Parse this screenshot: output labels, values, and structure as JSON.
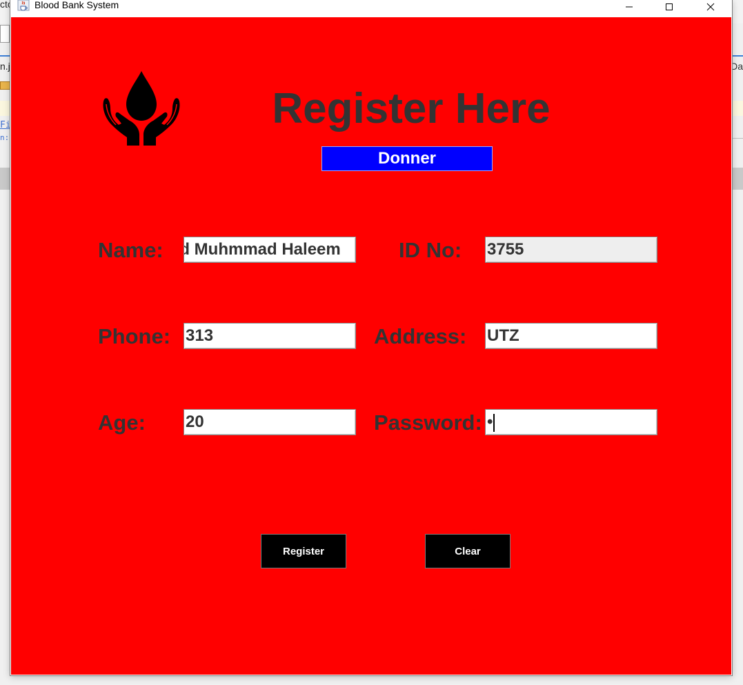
{
  "background": {
    "left_fragments": [
      "ctc",
      "n.ja",
      "Fi",
      "n:"
    ],
    "right_fragments": [
      "rDa"
    ]
  },
  "window": {
    "title": "Blood Bank System",
    "controls": {
      "minimize": "minimize",
      "maximize": "maximize",
      "close": "close"
    }
  },
  "form": {
    "heading": "Register Here",
    "role": "Donner",
    "fields": {
      "name": {
        "label": "Name:",
        "value": "ed Muhmmad Haleem"
      },
      "id": {
        "label": "ID No:",
        "value": "3755"
      },
      "phone": {
        "label": "Phone:",
        "value": "313"
      },
      "address": {
        "label": "Address:",
        "value": "UTZ"
      },
      "age": {
        "label": "Age:",
        "value": "20"
      },
      "password": {
        "label": "Password:",
        "value": "•"
      }
    },
    "buttons": {
      "register": "Register",
      "clear": "Clear"
    }
  },
  "colors": {
    "panel": "#ff0000",
    "badge": "#0000ff",
    "label_text": "#333333",
    "button": "#000000"
  },
  "icons": {
    "logo": "blood-drop-hands-icon",
    "app": "java-cup-icon"
  }
}
